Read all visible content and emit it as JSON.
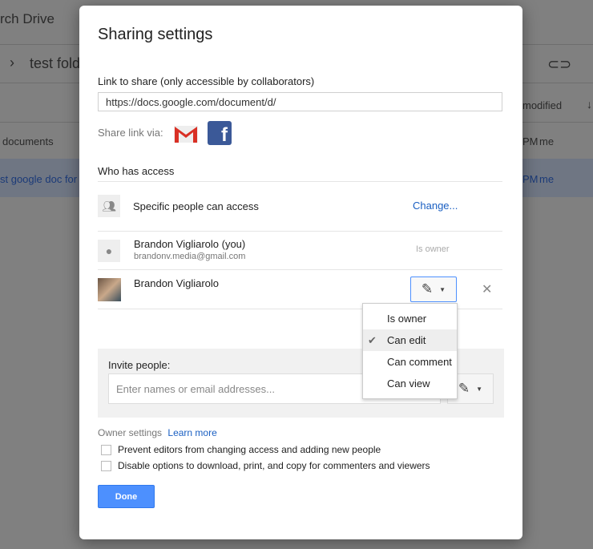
{
  "background": {
    "search": "rch Drive",
    "folder": "test fold",
    "col_modified": "modified",
    "row1_name": "documents",
    "row1_time": "PM",
    "row1_owner": "me",
    "row2_name": "st google doc for s",
    "row2_time": "PM",
    "row2_owner": "me"
  },
  "dialog": {
    "title": "Sharing settings",
    "link_label": "Link to share (only accessible by collaborators)",
    "link_value": "https://docs.google.com/document/d/",
    "share_via": "Share link via:",
    "who_has_access": "Who has access",
    "access_level": "Specific people can access",
    "change": "Change...",
    "people": [
      {
        "name": "Brandon Vigliarolo (you)",
        "email": "brandonv.media@gmail.com",
        "role": "Is owner"
      },
      {
        "name": "Brandon Vigliarolo"
      }
    ],
    "menu": {
      "items": [
        "Is owner",
        "Can edit",
        "Can comment",
        "Can view"
      ],
      "selected": "Can edit"
    },
    "invite_label": "Invite people:",
    "invite_placeholder": "Enter names or email addresses...",
    "owner_settings": "Owner settings",
    "learn_more": "Learn more",
    "options": [
      "Prevent editors from changing access and adding new people",
      "Disable options to download, print, and copy for commenters and viewers"
    ],
    "done": "Done"
  }
}
